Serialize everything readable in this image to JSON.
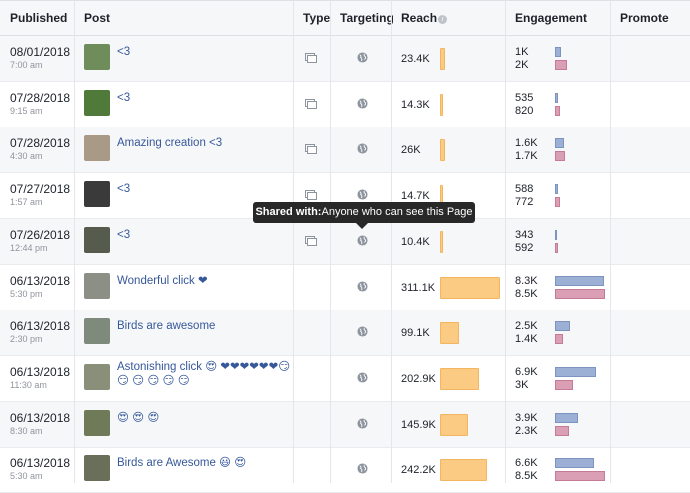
{
  "headers": {
    "published": "Published",
    "post": "Post",
    "type": "Type",
    "targeting": "Targeting",
    "reach": "Reach",
    "engagement": "Engagement",
    "promote": "Promote"
  },
  "reach_info_icon": "i",
  "tooltip": {
    "label": "Shared with:",
    "value": "Anyone who can see this Page"
  },
  "colors": {
    "reach_bar": "#fccb83",
    "engagement_bar_1": "#9cb0d6",
    "engagement_bar_2": "#da9fb4",
    "link": "#365899"
  },
  "rows": [
    {
      "date": "08/01/2018",
      "time": "7:00 am",
      "text": "<3",
      "has_type": true,
      "reach": "23.4K",
      "reach_value": 23400,
      "eng1": "1K",
      "eng1_value": 1000,
      "eng2": "2K",
      "eng2_value": 2000,
      "thumb_color": "#6f8d5a"
    },
    {
      "date": "07/28/2018",
      "time": "9:15 am",
      "text": "<3",
      "has_type": true,
      "reach": "14.3K",
      "reach_value": 14300,
      "eng1": "535",
      "eng1_value": 535,
      "eng2": "820",
      "eng2_value": 820,
      "thumb_color": "#4f7a3a"
    },
    {
      "date": "07/28/2018",
      "time": "4:30 am",
      "text": "Amazing creation <3",
      "has_type": true,
      "reach": "26K",
      "reach_value": 26000,
      "eng1": "1.6K",
      "eng1_value": 1600,
      "eng2": "1.7K",
      "eng2_value": 1700,
      "thumb_color": "#a89a86"
    },
    {
      "date": "07/27/2018",
      "time": "1:57 am",
      "text": "<3",
      "has_type": true,
      "reach": "14.7K",
      "reach_value": 14700,
      "eng1": "588",
      "eng1_value": 588,
      "eng2": "772",
      "eng2_value": 772,
      "thumb_color": "#3a3a3a"
    },
    {
      "date": "07/26/2018",
      "time": "12:44 pm",
      "text": "<3",
      "has_type": true,
      "reach": "10.4K",
      "reach_value": 10400,
      "eng1": "343",
      "eng1_value": 343,
      "eng2": "592",
      "eng2_value": 592,
      "thumb_color": "#555b4d"
    },
    {
      "date": "06/13/2018",
      "time": "5:30 pm",
      "text": "Wonderful click ❤",
      "has_type": false,
      "reach": "311.1K",
      "reach_value": 311100,
      "eng1": "8.3K",
      "eng1_value": 8300,
      "eng2": "8.5K",
      "eng2_value": 8500,
      "thumb_color": "#8b8f86"
    },
    {
      "date": "06/13/2018",
      "time": "2:30 pm",
      "text": "Birds are awesome",
      "has_type": false,
      "reach": "99.1K",
      "reach_value": 99100,
      "eng1": "2.5K",
      "eng1_value": 2500,
      "eng2": "1.4K",
      "eng2_value": 1400,
      "thumb_color": "#7d8a7c"
    },
    {
      "date": "06/13/2018",
      "time": "11:30 am",
      "text": "Astonishing click 😍 ❤❤❤❤❤❤😏",
      "text2": "😏 😏 😏 😏 😏",
      "has_type": false,
      "reach": "202.9K",
      "reach_value": 202900,
      "eng1": "6.9K",
      "eng1_value": 6900,
      "eng2": "3K",
      "eng2_value": 3000,
      "thumb_color": "#8a8f79"
    },
    {
      "date": "06/13/2018",
      "time": "8:30 am",
      "text": "😍 😍 😍",
      "has_type": false,
      "reach": "145.9K",
      "reach_value": 145900,
      "eng1": "3.9K",
      "eng1_value": 3900,
      "eng2": "2.3K",
      "eng2_value": 2300,
      "thumb_color": "#6f7a58"
    },
    {
      "date": "06/13/2018",
      "time": "5:30 am",
      "text": "Birds are Awesome 😃 😍",
      "has_type": false,
      "reach": "242.2K",
      "reach_value": 242200,
      "eng1": "6.6K",
      "eng1_value": 6600,
      "eng2": "8.5K",
      "eng2_value": 8500,
      "thumb_color": "#6a6f5a"
    }
  ]
}
